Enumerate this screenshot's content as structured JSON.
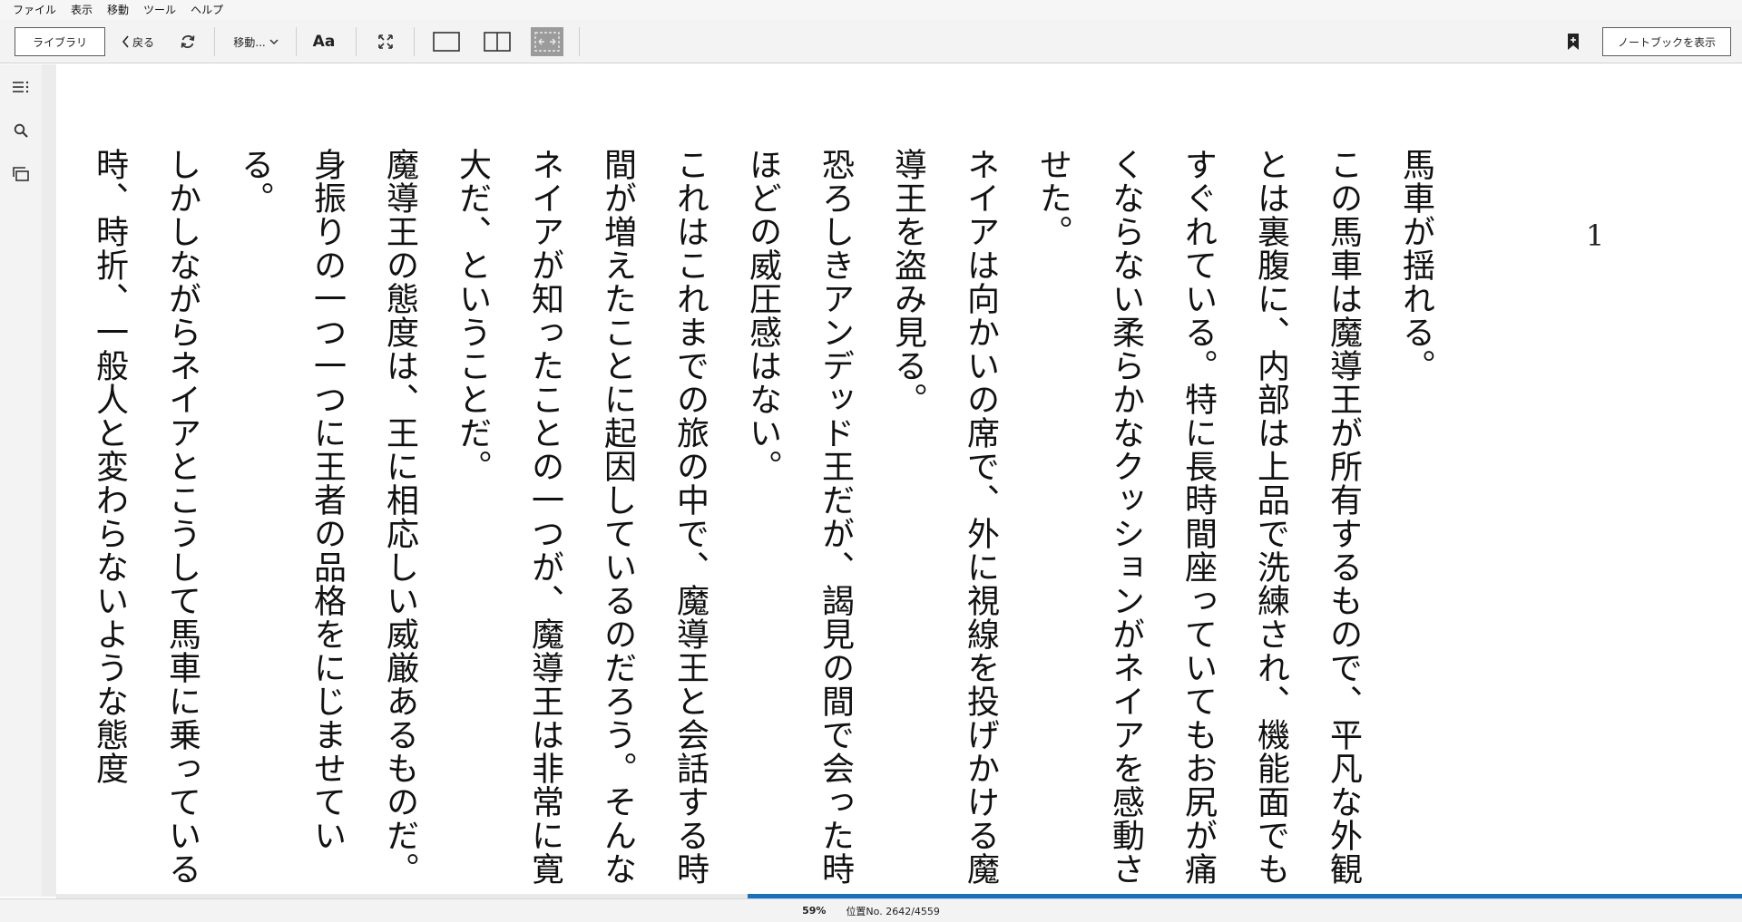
{
  "menu": [
    "ファイル",
    "表示",
    "移動",
    "ツール",
    "ヘルプ"
  ],
  "toolbar": {
    "library_label": "ライブラリ",
    "back_label": "戻る",
    "goto_label": "移動...",
    "font_label": "Aa",
    "notebook_label": "ノートブックを表示"
  },
  "reader": {
    "chapter_number": "1",
    "paragraphs": [
      "馬車が揺れる。",
      "この馬車は魔導王が所有するもので、平凡な外観とは裏腹に、内部は上品で洗練され、機能面でもすぐれている。特に長時間座っていてもお尻が痛くならない柔らかなクッションがネイアを感動させた。",
      "ネイアは向かいの席で、外に視線を投げかける魔導王を盗み見る。",
      "恐ろしきアンデッド王だが、謁見の間で会った時ほどの威圧感はない。",
      "これはこれまでの旅の中で、魔導王と会話する時間が増えたことに起因しているのだろう。そんなネイアが知ったことの一つが、魔導王は非常に寛大だ、ということだ。",
      "魔導王の態度は、王に相応しい威厳あるものだ。身振りの一つ一つに王者の品格をにじませている。",
      "しかしながらネイアとこうして馬車に乗っている時、時折、一般人と変わらないような態度"
    ]
  },
  "progress": {
    "percent_label": "59%",
    "fraction": 0.59,
    "location_label": "位置No. 2642/4559"
  }
}
